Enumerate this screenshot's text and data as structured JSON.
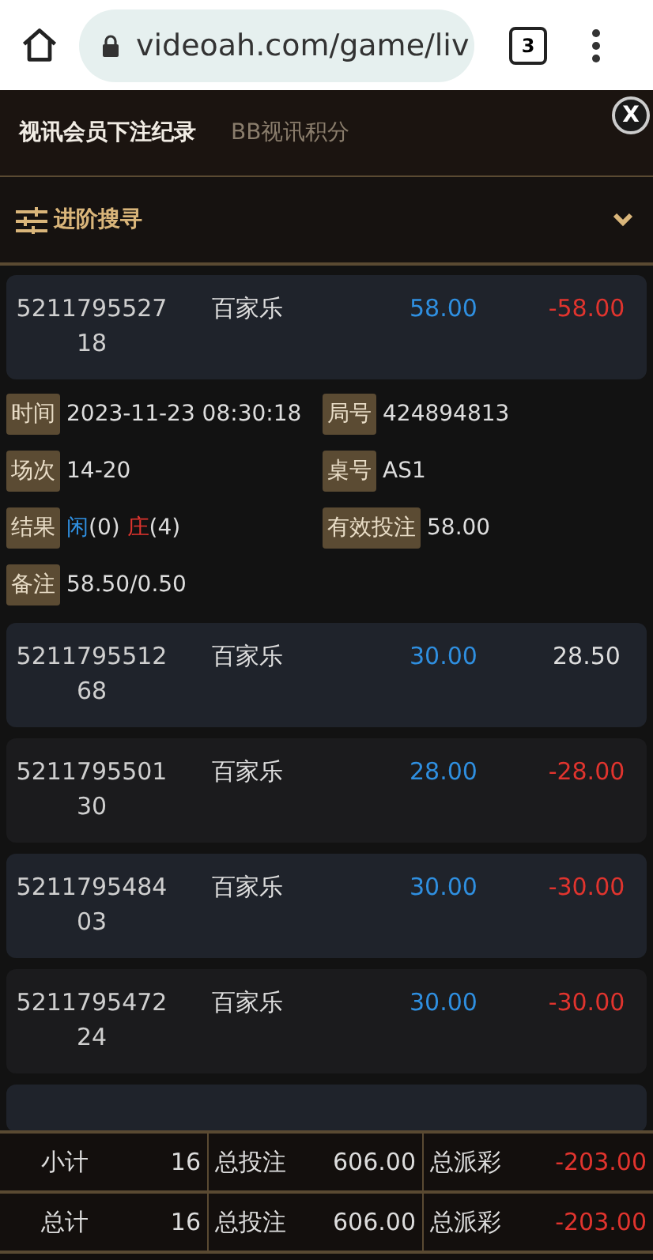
{
  "browser": {
    "url": "videoah.com/game/liv",
    "tab_count": "3"
  },
  "tabs": [
    {
      "label": "视讯会员下注纪录",
      "selected": true
    },
    {
      "label": "BB视讯积分",
      "selected": false
    }
  ],
  "close_button": "X",
  "advanced_search": {
    "label": "进阶搜寻",
    "expanded": false
  },
  "records": [
    {
      "id": "521179552718",
      "game": "百家乐",
      "amount": "58.00",
      "payout": "-58.00",
      "win": false,
      "details": [
        {
          "label": "时间",
          "value": "2023-11-23 08:30:18"
        },
        {
          "label": "局号",
          "value": "424894813"
        },
        {
          "label": "场次",
          "value": "14-20"
        },
        {
          "label": "桌号",
          "value": "AS1"
        },
        {
          "label": "结果",
          "parts": [
            {
              "text": "闲",
              "color": "#2f8fe0"
            },
            {
              "text": "(0) "
            },
            {
              "text": "庄",
              "color": "#e0342e"
            },
            {
              "text": "(4)"
            }
          ]
        },
        {
          "label": "有效投注",
          "value": "58.00"
        },
        {
          "label": "备注",
          "value": "58.50/0.50"
        }
      ]
    },
    {
      "id": "521179551268",
      "game": "百家乐",
      "amount": "30.00",
      "payout": "28.50",
      "win": true
    },
    {
      "id": "521179550130",
      "game": "百家乐",
      "amount": "28.00",
      "payout": "-28.00",
      "win": false
    },
    {
      "id": "521179548403",
      "game": "百家乐",
      "amount": "30.00",
      "payout": "-30.00",
      "win": false
    },
    {
      "id": "521179547224",
      "game": "百家乐",
      "amount": "30.00",
      "payout": "-30.00",
      "win": false
    }
  ],
  "totals": [
    {
      "label": "小计",
      "count": "16",
      "bet_label": "总投注",
      "bet": "606.00",
      "payout_label": "总派彩",
      "payout": "-203.00"
    },
    {
      "label": "总计",
      "count": "16",
      "bet_label": "总投注",
      "bet": "606.00",
      "payout_label": "总派彩",
      "payout": "-203.00"
    }
  ]
}
